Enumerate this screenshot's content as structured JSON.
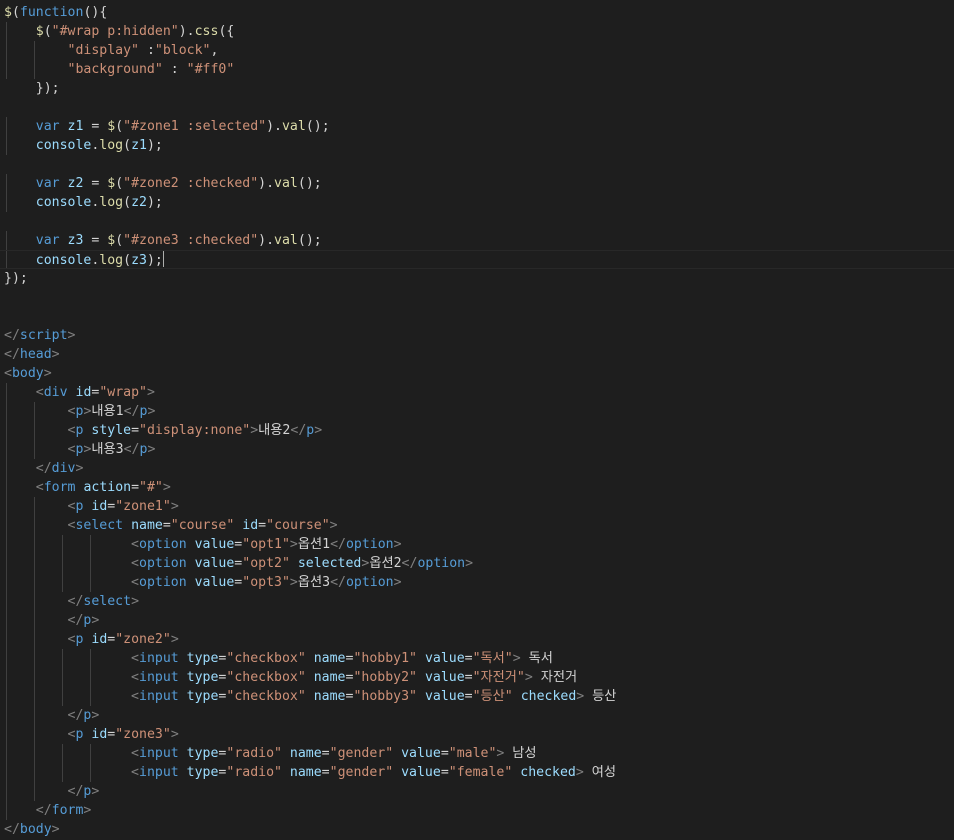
{
  "editor": {
    "language": "html",
    "theme_colors": {
      "background": "#1e1e1e",
      "keyword": "#569cd6",
      "function": "#dcdcaa",
      "string": "#ce9178",
      "variable": "#9cdcfe",
      "text": "#d4d4d4",
      "tag_punctuation": "#808080"
    },
    "cursor_line": 13,
    "lines": [
      [
        [
          "$",
          "t-fn"
        ],
        [
          "(",
          "t-pun"
        ],
        [
          "function",
          "t-kw"
        ],
        [
          "(){",
          "t-pun"
        ]
      ],
      [
        [
          "    ",
          "t-pun"
        ],
        [
          "$",
          "t-fn"
        ],
        [
          "(",
          "t-pun"
        ],
        [
          "\"#wrap p:hidden\"",
          "t-str"
        ],
        [
          ").",
          "t-pun"
        ],
        [
          "css",
          "t-fn"
        ],
        [
          "({",
          "t-pun"
        ]
      ],
      [
        [
          "        ",
          "t-pun"
        ],
        [
          "\"display\"",
          "t-str"
        ],
        [
          " :",
          "t-pun"
        ],
        [
          "\"block\"",
          "t-str"
        ],
        [
          ",",
          "t-pun"
        ]
      ],
      [
        [
          "        ",
          "t-pun"
        ],
        [
          "\"background\"",
          "t-str"
        ],
        [
          " : ",
          "t-pun"
        ],
        [
          "\"#ff0\"",
          "t-str"
        ]
      ],
      [
        [
          "    });",
          "t-pun"
        ]
      ],
      [],
      [
        [
          "    ",
          "t-pun"
        ],
        [
          "var",
          "t-kw"
        ],
        [
          " ",
          "t-pun"
        ],
        [
          "z1",
          "t-var"
        ],
        [
          " = ",
          "t-pun"
        ],
        [
          "$",
          "t-fn"
        ],
        [
          "(",
          "t-pun"
        ],
        [
          "\"#zone1 :selected\"",
          "t-str"
        ],
        [
          ").",
          "t-pun"
        ],
        [
          "val",
          "t-fn"
        ],
        [
          "();",
          "t-pun"
        ]
      ],
      [
        [
          "    ",
          "t-pun"
        ],
        [
          "console",
          "t-var"
        ],
        [
          ".",
          "t-pun"
        ],
        [
          "log",
          "t-fn"
        ],
        [
          "(",
          "t-pun"
        ],
        [
          "z1",
          "t-var"
        ],
        [
          ");",
          "t-pun"
        ]
      ],
      [],
      [
        [
          "    ",
          "t-pun"
        ],
        [
          "var",
          "t-kw"
        ],
        [
          " ",
          "t-pun"
        ],
        [
          "z2",
          "t-var"
        ],
        [
          " = ",
          "t-pun"
        ],
        [
          "$",
          "t-fn"
        ],
        [
          "(",
          "t-pun"
        ],
        [
          "\"#zone2 :checked\"",
          "t-str"
        ],
        [
          ").",
          "t-pun"
        ],
        [
          "val",
          "t-fn"
        ],
        [
          "();",
          "t-pun"
        ]
      ],
      [
        [
          "    ",
          "t-pun"
        ],
        [
          "console",
          "t-var"
        ],
        [
          ".",
          "t-pun"
        ],
        [
          "log",
          "t-fn"
        ],
        [
          "(",
          "t-pun"
        ],
        [
          "z2",
          "t-var"
        ],
        [
          ");",
          "t-pun"
        ]
      ],
      [],
      [
        [
          "    ",
          "t-pun"
        ],
        [
          "var",
          "t-kw"
        ],
        [
          " ",
          "t-pun"
        ],
        [
          "z3",
          "t-var"
        ],
        [
          " = ",
          "t-pun"
        ],
        [
          "$",
          "t-fn"
        ],
        [
          "(",
          "t-pun"
        ],
        [
          "\"#zone3 :checked\"",
          "t-str"
        ],
        [
          ").",
          "t-pun"
        ],
        [
          "val",
          "t-fn"
        ],
        [
          "();",
          "t-pun"
        ]
      ],
      [
        [
          "    ",
          "t-pun"
        ],
        [
          "console",
          "t-var"
        ],
        [
          ".",
          "t-pun"
        ],
        [
          "log",
          "t-fn"
        ],
        [
          "(",
          "t-pun"
        ],
        [
          "z3",
          "t-var"
        ],
        [
          ");",
          "t-pun"
        ]
      ],
      [
        [
          "});",
          "t-pun"
        ]
      ],
      [],
      [],
      [
        [
          "</",
          "t-tagp"
        ],
        [
          "script",
          "t-tag"
        ],
        [
          ">",
          "t-tagp"
        ]
      ],
      [
        [
          "</",
          "t-tagp"
        ],
        [
          "head",
          "t-tag"
        ],
        [
          ">",
          "t-tagp"
        ]
      ],
      [
        [
          "<",
          "t-tagp"
        ],
        [
          "body",
          "t-tag"
        ],
        [
          ">",
          "t-tagp"
        ]
      ],
      [
        [
          "    ",
          "t-text"
        ],
        [
          "<",
          "t-tagp"
        ],
        [
          "div",
          "t-tag"
        ],
        [
          " ",
          "t-text"
        ],
        [
          "id",
          "t-attr"
        ],
        [
          "=",
          "t-text"
        ],
        [
          "\"wrap\"",
          "t-str"
        ],
        [
          ">",
          "t-tagp"
        ]
      ],
      [
        [
          "        ",
          "t-text"
        ],
        [
          "<",
          "t-tagp"
        ],
        [
          "p",
          "t-tag"
        ],
        [
          ">",
          "t-tagp"
        ],
        [
          "내용1",
          "t-text"
        ],
        [
          "</",
          "t-tagp"
        ],
        [
          "p",
          "t-tag"
        ],
        [
          ">",
          "t-tagp"
        ]
      ],
      [
        [
          "        ",
          "t-text"
        ],
        [
          "<",
          "t-tagp"
        ],
        [
          "p",
          "t-tag"
        ],
        [
          " ",
          "t-text"
        ],
        [
          "style",
          "t-attr"
        ],
        [
          "=",
          "t-text"
        ],
        [
          "\"display:none\"",
          "t-str"
        ],
        [
          ">",
          "t-tagp"
        ],
        [
          "내용2",
          "t-text"
        ],
        [
          "</",
          "t-tagp"
        ],
        [
          "p",
          "t-tag"
        ],
        [
          ">",
          "t-tagp"
        ]
      ],
      [
        [
          "        ",
          "t-text"
        ],
        [
          "<",
          "t-tagp"
        ],
        [
          "p",
          "t-tag"
        ],
        [
          ">",
          "t-tagp"
        ],
        [
          "내용3",
          "t-text"
        ],
        [
          "</",
          "t-tagp"
        ],
        [
          "p",
          "t-tag"
        ],
        [
          ">",
          "t-tagp"
        ]
      ],
      [
        [
          "    ",
          "t-text"
        ],
        [
          "</",
          "t-tagp"
        ],
        [
          "div",
          "t-tag"
        ],
        [
          ">",
          "t-tagp"
        ]
      ],
      [
        [
          "    ",
          "t-text"
        ],
        [
          "<",
          "t-tagp"
        ],
        [
          "form",
          "t-tag"
        ],
        [
          " ",
          "t-text"
        ],
        [
          "action",
          "t-attr"
        ],
        [
          "=",
          "t-text"
        ],
        [
          "\"#\"",
          "t-str"
        ],
        [
          ">",
          "t-tagp"
        ]
      ],
      [
        [
          "        ",
          "t-text"
        ],
        [
          "<",
          "t-tagp"
        ],
        [
          "p",
          "t-tag"
        ],
        [
          " ",
          "t-text"
        ],
        [
          "id",
          "t-attr"
        ],
        [
          "=",
          "t-text"
        ],
        [
          "\"zone1\"",
          "t-str"
        ],
        [
          ">",
          "t-tagp"
        ]
      ],
      [
        [
          "        ",
          "t-text"
        ],
        [
          "<",
          "t-tagp"
        ],
        [
          "select",
          "t-tag"
        ],
        [
          " ",
          "t-text"
        ],
        [
          "name",
          "t-attr"
        ],
        [
          "=",
          "t-text"
        ],
        [
          "\"course\"",
          "t-str"
        ],
        [
          " ",
          "t-text"
        ],
        [
          "id",
          "t-attr"
        ],
        [
          "=",
          "t-text"
        ],
        [
          "\"course\"",
          "t-str"
        ],
        [
          ">",
          "t-tagp"
        ]
      ],
      [
        [
          "                ",
          "t-text"
        ],
        [
          "<",
          "t-tagp"
        ],
        [
          "option",
          "t-tag"
        ],
        [
          " ",
          "t-text"
        ],
        [
          "value",
          "t-attr"
        ],
        [
          "=",
          "t-text"
        ],
        [
          "\"opt1\"",
          "t-str"
        ],
        [
          ">",
          "t-tagp"
        ],
        [
          "옵션1",
          "t-text"
        ],
        [
          "</",
          "t-tagp"
        ],
        [
          "option",
          "t-tag"
        ],
        [
          ">",
          "t-tagp"
        ]
      ],
      [
        [
          "                ",
          "t-text"
        ],
        [
          "<",
          "t-tagp"
        ],
        [
          "option",
          "t-tag"
        ],
        [
          " ",
          "t-text"
        ],
        [
          "value",
          "t-attr"
        ],
        [
          "=",
          "t-text"
        ],
        [
          "\"opt2\"",
          "t-str"
        ],
        [
          " ",
          "t-text"
        ],
        [
          "selected",
          "t-attr"
        ],
        [
          ">",
          "t-tagp"
        ],
        [
          "옵션2",
          "t-text"
        ],
        [
          "</",
          "t-tagp"
        ],
        [
          "option",
          "t-tag"
        ],
        [
          ">",
          "t-tagp"
        ]
      ],
      [
        [
          "                ",
          "t-text"
        ],
        [
          "<",
          "t-tagp"
        ],
        [
          "option",
          "t-tag"
        ],
        [
          " ",
          "t-text"
        ],
        [
          "value",
          "t-attr"
        ],
        [
          "=",
          "t-text"
        ],
        [
          "\"opt3\"",
          "t-str"
        ],
        [
          ">",
          "t-tagp"
        ],
        [
          "옵션3",
          "t-text"
        ],
        [
          "</",
          "t-tagp"
        ],
        [
          "option",
          "t-tag"
        ],
        [
          ">",
          "t-tagp"
        ]
      ],
      [
        [
          "        ",
          "t-text"
        ],
        [
          "</",
          "t-tagp"
        ],
        [
          "select",
          "t-tag"
        ],
        [
          ">",
          "t-tagp"
        ]
      ],
      [
        [
          "        ",
          "t-text"
        ],
        [
          "</",
          "t-tagp"
        ],
        [
          "p",
          "t-tag"
        ],
        [
          ">",
          "t-tagp"
        ]
      ],
      [
        [
          "        ",
          "t-text"
        ],
        [
          "<",
          "t-tagp"
        ],
        [
          "p",
          "t-tag"
        ],
        [
          " ",
          "t-text"
        ],
        [
          "id",
          "t-attr"
        ],
        [
          "=",
          "t-text"
        ],
        [
          "\"zone2\"",
          "t-str"
        ],
        [
          ">",
          "t-tagp"
        ]
      ],
      [
        [
          "                ",
          "t-text"
        ],
        [
          "<",
          "t-tagp"
        ],
        [
          "input",
          "t-tag"
        ],
        [
          " ",
          "t-text"
        ],
        [
          "type",
          "t-attr"
        ],
        [
          "=",
          "t-text"
        ],
        [
          "\"checkbox\"",
          "t-str"
        ],
        [
          " ",
          "t-text"
        ],
        [
          "name",
          "t-attr"
        ],
        [
          "=",
          "t-text"
        ],
        [
          "\"hobby1\"",
          "t-str"
        ],
        [
          " ",
          "t-text"
        ],
        [
          "value",
          "t-attr"
        ],
        [
          "=",
          "t-text"
        ],
        [
          "\"독서\"",
          "t-str"
        ],
        [
          ">",
          "t-tagp"
        ],
        [
          " 독서",
          "t-text"
        ]
      ],
      [
        [
          "                ",
          "t-text"
        ],
        [
          "<",
          "t-tagp"
        ],
        [
          "input",
          "t-tag"
        ],
        [
          " ",
          "t-text"
        ],
        [
          "type",
          "t-attr"
        ],
        [
          "=",
          "t-text"
        ],
        [
          "\"checkbox\"",
          "t-str"
        ],
        [
          " ",
          "t-text"
        ],
        [
          "name",
          "t-attr"
        ],
        [
          "=",
          "t-text"
        ],
        [
          "\"hobby2\"",
          "t-str"
        ],
        [
          " ",
          "t-text"
        ],
        [
          "value",
          "t-attr"
        ],
        [
          "=",
          "t-text"
        ],
        [
          "\"자전거\"",
          "t-str"
        ],
        [
          ">",
          "t-tagp"
        ],
        [
          " 자전거",
          "t-text"
        ]
      ],
      [
        [
          "                ",
          "t-text"
        ],
        [
          "<",
          "t-tagp"
        ],
        [
          "input",
          "t-tag"
        ],
        [
          " ",
          "t-text"
        ],
        [
          "type",
          "t-attr"
        ],
        [
          "=",
          "t-text"
        ],
        [
          "\"checkbox\"",
          "t-str"
        ],
        [
          " ",
          "t-text"
        ],
        [
          "name",
          "t-attr"
        ],
        [
          "=",
          "t-text"
        ],
        [
          "\"hobby3\"",
          "t-str"
        ],
        [
          " ",
          "t-text"
        ],
        [
          "value",
          "t-attr"
        ],
        [
          "=",
          "t-text"
        ],
        [
          "\"등산\"",
          "t-str"
        ],
        [
          " ",
          "t-text"
        ],
        [
          "checked",
          "t-attr"
        ],
        [
          ">",
          "t-tagp"
        ],
        [
          " 등산",
          "t-text"
        ]
      ],
      [
        [
          "        ",
          "t-text"
        ],
        [
          "</",
          "t-tagp"
        ],
        [
          "p",
          "t-tag"
        ],
        [
          ">",
          "t-tagp"
        ]
      ],
      [
        [
          "        ",
          "t-text"
        ],
        [
          "<",
          "t-tagp"
        ],
        [
          "p",
          "t-tag"
        ],
        [
          " ",
          "t-text"
        ],
        [
          "id",
          "t-attr"
        ],
        [
          "=",
          "t-text"
        ],
        [
          "\"zone3\"",
          "t-str"
        ],
        [
          ">",
          "t-tagp"
        ]
      ],
      [
        [
          "                ",
          "t-text"
        ],
        [
          "<",
          "t-tagp"
        ],
        [
          "input",
          "t-tag"
        ],
        [
          " ",
          "t-text"
        ],
        [
          "type",
          "t-attr"
        ],
        [
          "=",
          "t-text"
        ],
        [
          "\"radio\"",
          "t-str"
        ],
        [
          " ",
          "t-text"
        ],
        [
          "name",
          "t-attr"
        ],
        [
          "=",
          "t-text"
        ],
        [
          "\"gender\"",
          "t-str"
        ],
        [
          " ",
          "t-text"
        ],
        [
          "value",
          "t-attr"
        ],
        [
          "=",
          "t-text"
        ],
        [
          "\"male\"",
          "t-str"
        ],
        [
          ">",
          "t-tagp"
        ],
        [
          " 남성",
          "t-text"
        ]
      ],
      [
        [
          "                ",
          "t-text"
        ],
        [
          "<",
          "t-tagp"
        ],
        [
          "input",
          "t-tag"
        ],
        [
          " ",
          "t-text"
        ],
        [
          "type",
          "t-attr"
        ],
        [
          "=",
          "t-text"
        ],
        [
          "\"radio\"",
          "t-str"
        ],
        [
          " ",
          "t-text"
        ],
        [
          "name",
          "t-attr"
        ],
        [
          "=",
          "t-text"
        ],
        [
          "\"gender\"",
          "t-str"
        ],
        [
          " ",
          "t-text"
        ],
        [
          "value",
          "t-attr"
        ],
        [
          "=",
          "t-text"
        ],
        [
          "\"female\"",
          "t-str"
        ],
        [
          " ",
          "t-text"
        ],
        [
          "checked",
          "t-attr"
        ],
        [
          ">",
          "t-tagp"
        ],
        [
          " 여성",
          "t-text"
        ]
      ],
      [
        [
          "        ",
          "t-text"
        ],
        [
          "</",
          "t-tagp"
        ],
        [
          "p",
          "t-tag"
        ],
        [
          ">",
          "t-tagp"
        ]
      ],
      [
        [
          "    ",
          "t-text"
        ],
        [
          "</",
          "t-tagp"
        ],
        [
          "form",
          "t-tag"
        ],
        [
          ">",
          "t-tagp"
        ]
      ],
      [
        [
          "</",
          "t-tagp"
        ],
        [
          "body",
          "t-tag"
        ],
        [
          ">",
          "t-tagp"
        ]
      ]
    ]
  }
}
